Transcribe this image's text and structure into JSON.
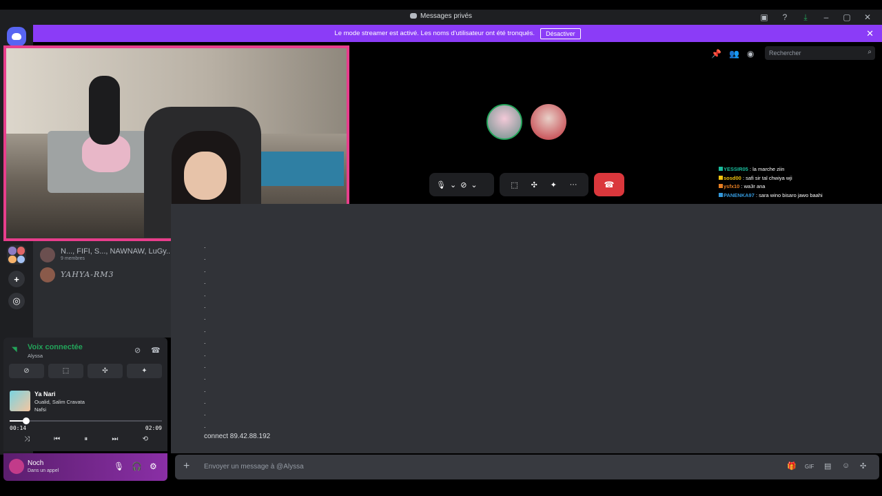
{
  "window": {
    "title": "Messages privés",
    "controls": [
      "▣",
      "?",
      "⤓",
      "–",
      "▢",
      "✕"
    ]
  },
  "banner": {
    "text": "Le mode streamer est activé. Les noms d'utilisateur ont été tronqués.",
    "button": "Désactiver",
    "close": "✕"
  },
  "rail": {
    "add": "+",
    "explore": "◎"
  },
  "dms": [
    {
      "name": "N..., FIFI, S..., NAWNAW, LuGy...",
      "sub": "9 membres"
    },
    {
      "name": "YAHYA-RM3",
      "sub": ""
    }
  ],
  "voice": {
    "title": "Voix connectée",
    "sub": "Alyssa",
    "buttons": [
      "⊘",
      "⬚",
      "✣",
      "✦"
    ],
    "music": {
      "song": "Ya Nari",
      "artist": "Oualid, Salim Cravata",
      "album": "Nafsi",
      "elapsed": "00:14",
      "total": "02:09",
      "progress_fraction": 0.11,
      "controls": [
        "⤨",
        "⏮",
        "⏸",
        "⏭",
        "⟲"
      ]
    }
  },
  "user": {
    "name": "Noch",
    "status": "Dans un appel",
    "icons": [
      "🎙",
      "🎧",
      "⚙"
    ]
  },
  "call": {
    "header_icons": [
      "📌",
      "👥",
      "◉"
    ],
    "search_placeholder": "Rechercher",
    "controls_left": [
      "🎙",
      "⌄",
      "⊘",
      "⌄"
    ],
    "controls_mid": [
      "⬚",
      "✣",
      "✦",
      "···"
    ],
    "hangup": "☎",
    "chat": [
      {
        "user": "YESSIR05",
        "msg": " : la marche ziin",
        "color": "#1abc9c"
      },
      {
        "user": "sosd00",
        "msg": " : safi sir tal chwiya wji",
        "color": "#f1c40f"
      },
      {
        "user": "ysfx10",
        "msg": " : wa3r ana",
        "color": "#e67e22"
      },
      {
        "user": "PANENKA97",
        "msg": " : sara wino bisaro jawo baahi",
        "color": "#3498db"
      }
    ]
  },
  "messages": {
    "dots": [
      ".",
      ".",
      ".",
      ".",
      ".",
      ".",
      ".",
      ".",
      ".",
      ".",
      ".",
      ".",
      ".",
      ".",
      ".",
      "."
    ],
    "last": "connect 89.42.88.192"
  },
  "composer": {
    "placeholder": "Envoyer un message à @Alyssa",
    "icons": [
      "🎁",
      "GIF",
      "▤",
      "☺",
      "✣"
    ]
  }
}
